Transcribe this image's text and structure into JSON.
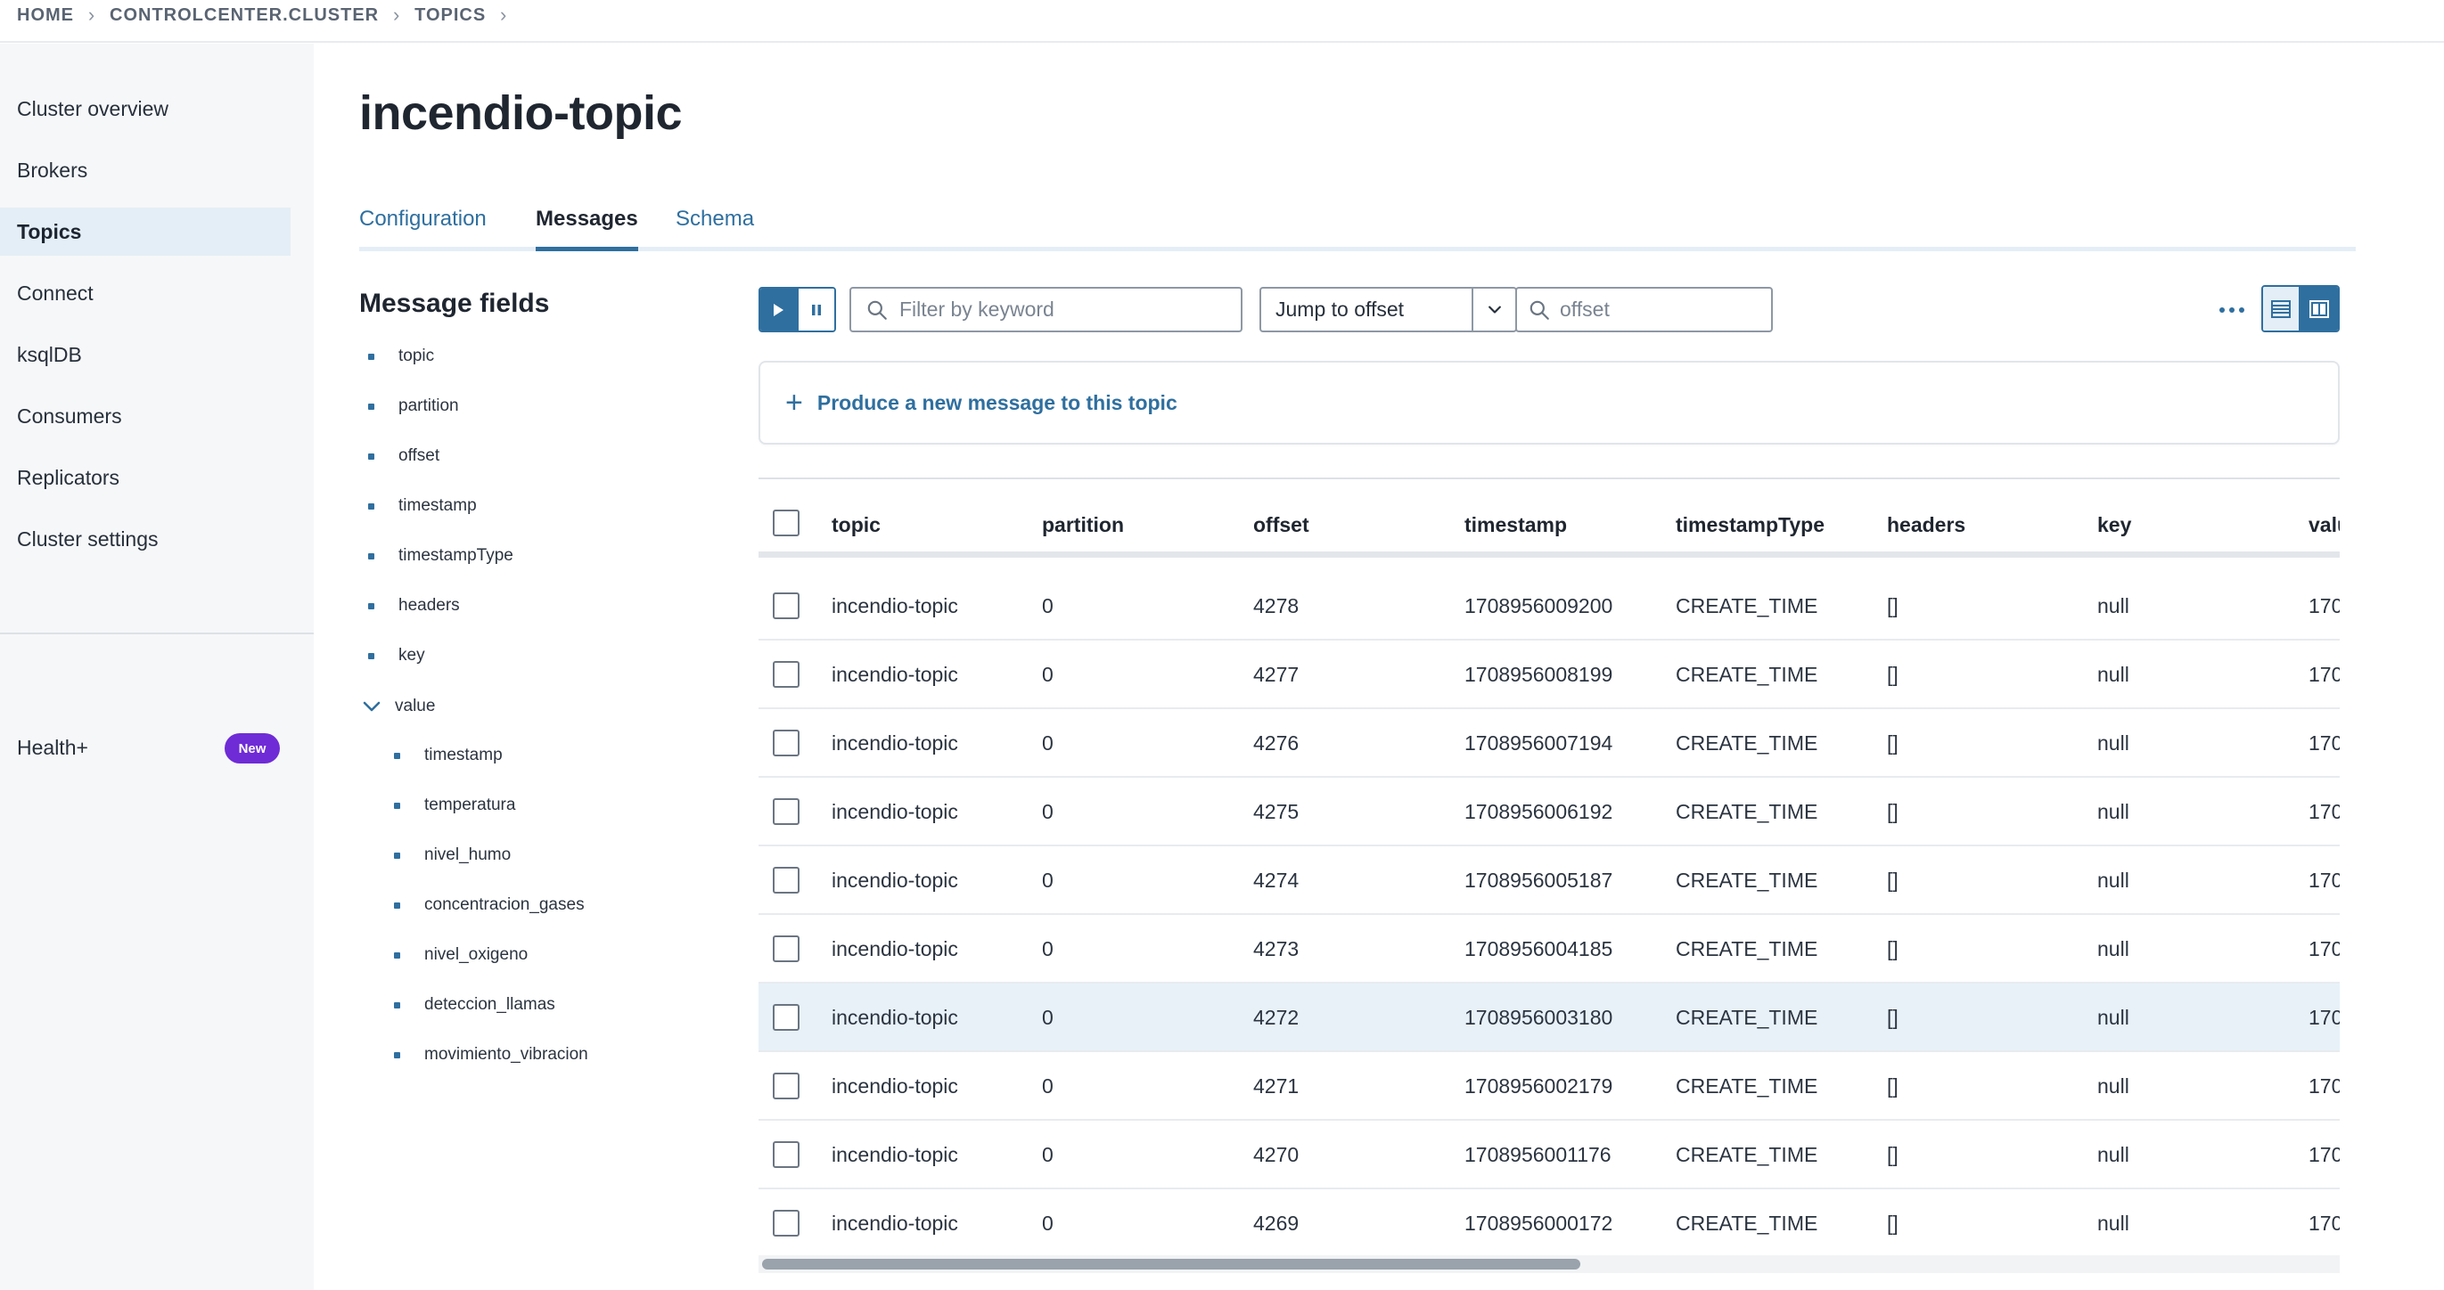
{
  "breadcrumb": [
    "HOME",
    "CONTROLCENTER.CLUSTER",
    "TOPICS"
  ],
  "sidebar": {
    "items": [
      {
        "label": "Cluster overview"
      },
      {
        "label": "Brokers"
      },
      {
        "label": "Topics",
        "active": true
      },
      {
        "label": "Connect"
      },
      {
        "label": "ksqlDB"
      },
      {
        "label": "Consumers"
      },
      {
        "label": "Replicators"
      },
      {
        "label": "Cluster settings"
      }
    ],
    "health_label": "Health+",
    "health_badge": "New"
  },
  "page": {
    "title": "incendio-topic",
    "tabs": [
      {
        "label": "Configuration"
      },
      {
        "label": "Messages",
        "active": true
      },
      {
        "label": "Schema"
      }
    ]
  },
  "message_fields": {
    "title": "Message fields",
    "fields": [
      "topic",
      "partition",
      "offset",
      "timestamp",
      "timestampType",
      "headers",
      "key"
    ],
    "value_label": "value",
    "value_fields": [
      "timestamp",
      "temperatura",
      "nivel_humo",
      "concentracion_gases",
      "nivel_oxigeno",
      "deteccion_llamas",
      "movimiento_vibracion"
    ]
  },
  "toolbar": {
    "filter_placeholder": "Filter by keyword",
    "jump_select": "Jump to offset",
    "offset_placeholder": "offset"
  },
  "produce": {
    "label": "Produce a new message to this topic"
  },
  "table": {
    "columns": [
      "topic",
      "partition",
      "offset",
      "timestamp",
      "timestampType",
      "headers",
      "key",
      "valu"
    ],
    "rows": [
      [
        "incendio-topic",
        "0",
        "4278",
        "1708956009200",
        "CREATE_TIME",
        "[]",
        "null",
        "170"
      ],
      [
        "incendio-topic",
        "0",
        "4277",
        "1708956008199",
        "CREATE_TIME",
        "[]",
        "null",
        "170"
      ],
      [
        "incendio-topic",
        "0",
        "4276",
        "1708956007194",
        "CREATE_TIME",
        "[]",
        "null",
        "170"
      ],
      [
        "incendio-topic",
        "0",
        "4275",
        "1708956006192",
        "CREATE_TIME",
        "[]",
        "null",
        "170"
      ],
      [
        "incendio-topic",
        "0",
        "4274",
        "1708956005187",
        "CREATE_TIME",
        "[]",
        "null",
        "170"
      ],
      [
        "incendio-topic",
        "0",
        "4273",
        "1708956004185",
        "CREATE_TIME",
        "[]",
        "null",
        "170"
      ],
      [
        "incendio-topic",
        "0",
        "4272",
        "1708956003180",
        "CREATE_TIME",
        "[]",
        "null",
        "170"
      ],
      [
        "incendio-topic",
        "0",
        "4271",
        "1708956002179",
        "CREATE_TIME",
        "[]",
        "null",
        "170"
      ],
      [
        "incendio-topic",
        "0",
        "4270",
        "1708956001176",
        "CREATE_TIME",
        "[]",
        "null",
        "170"
      ],
      [
        "incendio-topic",
        "0",
        "4269",
        "1708956000172",
        "CREATE_TIME",
        "[]",
        "null",
        "170"
      ]
    ],
    "highlighted_row": 6
  },
  "colors": {
    "accent": "#2f6f9f",
    "badge": "#6f2bd6",
    "active_nav_bg": "#e4eef6",
    "highlight_row": "#e8f1f8"
  }
}
